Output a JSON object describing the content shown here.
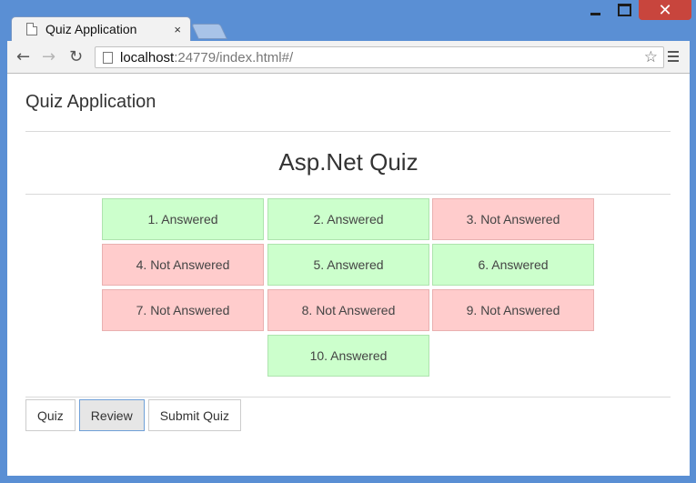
{
  "browser": {
    "tab_title": "Quiz Application",
    "tab_close": "×",
    "url_host": "localhost",
    "url_rest": ":24779/index.html#/",
    "close_glyph": "✕"
  },
  "app": {
    "title": "Quiz Application",
    "quiz_title": "Asp.Net Quiz"
  },
  "questions": [
    {
      "label": "1. Answered",
      "status": "answered"
    },
    {
      "label": "2. Answered",
      "status": "answered"
    },
    {
      "label": "3. Not Answered",
      "status": "not-answered"
    },
    {
      "label": "4. Not Answered",
      "status": "not-answered"
    },
    {
      "label": "5. Answered",
      "status": "answered"
    },
    {
      "label": "6. Answered",
      "status": "answered"
    },
    {
      "label": "7. Not Answered",
      "status": "not-answered"
    },
    {
      "label": "8. Not Answered",
      "status": "not-answered"
    },
    {
      "label": "9. Not Answered",
      "status": "not-answered"
    },
    {
      "label": "10. Answered",
      "status": "answered"
    }
  ],
  "buttons": {
    "quiz": "Quiz",
    "review": "Review",
    "submit": "Submit Quiz"
  },
  "colors": {
    "answered": "#ccffcc",
    "not_answered": "#ffcccc"
  }
}
